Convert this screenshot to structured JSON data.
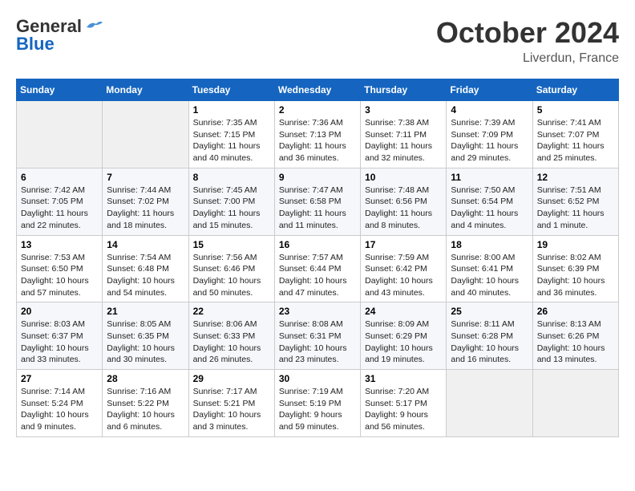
{
  "header": {
    "logo_line1": "General",
    "logo_line2": "Blue",
    "month_title": "October 2024",
    "location": "Liverdun, France"
  },
  "weekdays": [
    "Sunday",
    "Monday",
    "Tuesday",
    "Wednesday",
    "Thursday",
    "Friday",
    "Saturday"
  ],
  "weeks": [
    [
      {
        "day": "",
        "info": ""
      },
      {
        "day": "",
        "info": ""
      },
      {
        "day": "1",
        "info": "Sunrise: 7:35 AM\nSunset: 7:15 PM\nDaylight: 11 hours and 40 minutes."
      },
      {
        "day": "2",
        "info": "Sunrise: 7:36 AM\nSunset: 7:13 PM\nDaylight: 11 hours and 36 minutes."
      },
      {
        "day": "3",
        "info": "Sunrise: 7:38 AM\nSunset: 7:11 PM\nDaylight: 11 hours and 32 minutes."
      },
      {
        "day": "4",
        "info": "Sunrise: 7:39 AM\nSunset: 7:09 PM\nDaylight: 11 hours and 29 minutes."
      },
      {
        "day": "5",
        "info": "Sunrise: 7:41 AM\nSunset: 7:07 PM\nDaylight: 11 hours and 25 minutes."
      }
    ],
    [
      {
        "day": "6",
        "info": "Sunrise: 7:42 AM\nSunset: 7:05 PM\nDaylight: 11 hours and 22 minutes."
      },
      {
        "day": "7",
        "info": "Sunrise: 7:44 AM\nSunset: 7:02 PM\nDaylight: 11 hours and 18 minutes."
      },
      {
        "day": "8",
        "info": "Sunrise: 7:45 AM\nSunset: 7:00 PM\nDaylight: 11 hours and 15 minutes."
      },
      {
        "day": "9",
        "info": "Sunrise: 7:47 AM\nSunset: 6:58 PM\nDaylight: 11 hours and 11 minutes."
      },
      {
        "day": "10",
        "info": "Sunrise: 7:48 AM\nSunset: 6:56 PM\nDaylight: 11 hours and 8 minutes."
      },
      {
        "day": "11",
        "info": "Sunrise: 7:50 AM\nSunset: 6:54 PM\nDaylight: 11 hours and 4 minutes."
      },
      {
        "day": "12",
        "info": "Sunrise: 7:51 AM\nSunset: 6:52 PM\nDaylight: 11 hours and 1 minute."
      }
    ],
    [
      {
        "day": "13",
        "info": "Sunrise: 7:53 AM\nSunset: 6:50 PM\nDaylight: 10 hours and 57 minutes."
      },
      {
        "day": "14",
        "info": "Sunrise: 7:54 AM\nSunset: 6:48 PM\nDaylight: 10 hours and 54 minutes."
      },
      {
        "day": "15",
        "info": "Sunrise: 7:56 AM\nSunset: 6:46 PM\nDaylight: 10 hours and 50 minutes."
      },
      {
        "day": "16",
        "info": "Sunrise: 7:57 AM\nSunset: 6:44 PM\nDaylight: 10 hours and 47 minutes."
      },
      {
        "day": "17",
        "info": "Sunrise: 7:59 AM\nSunset: 6:42 PM\nDaylight: 10 hours and 43 minutes."
      },
      {
        "day": "18",
        "info": "Sunrise: 8:00 AM\nSunset: 6:41 PM\nDaylight: 10 hours and 40 minutes."
      },
      {
        "day": "19",
        "info": "Sunrise: 8:02 AM\nSunset: 6:39 PM\nDaylight: 10 hours and 36 minutes."
      }
    ],
    [
      {
        "day": "20",
        "info": "Sunrise: 8:03 AM\nSunset: 6:37 PM\nDaylight: 10 hours and 33 minutes."
      },
      {
        "day": "21",
        "info": "Sunrise: 8:05 AM\nSunset: 6:35 PM\nDaylight: 10 hours and 30 minutes."
      },
      {
        "day": "22",
        "info": "Sunrise: 8:06 AM\nSunset: 6:33 PM\nDaylight: 10 hours and 26 minutes."
      },
      {
        "day": "23",
        "info": "Sunrise: 8:08 AM\nSunset: 6:31 PM\nDaylight: 10 hours and 23 minutes."
      },
      {
        "day": "24",
        "info": "Sunrise: 8:09 AM\nSunset: 6:29 PM\nDaylight: 10 hours and 19 minutes."
      },
      {
        "day": "25",
        "info": "Sunrise: 8:11 AM\nSunset: 6:28 PM\nDaylight: 10 hours and 16 minutes."
      },
      {
        "day": "26",
        "info": "Sunrise: 8:13 AM\nSunset: 6:26 PM\nDaylight: 10 hours and 13 minutes."
      }
    ],
    [
      {
        "day": "27",
        "info": "Sunrise: 7:14 AM\nSunset: 5:24 PM\nDaylight: 10 hours and 9 minutes."
      },
      {
        "day": "28",
        "info": "Sunrise: 7:16 AM\nSunset: 5:22 PM\nDaylight: 10 hours and 6 minutes."
      },
      {
        "day": "29",
        "info": "Sunrise: 7:17 AM\nSunset: 5:21 PM\nDaylight: 10 hours and 3 minutes."
      },
      {
        "day": "30",
        "info": "Sunrise: 7:19 AM\nSunset: 5:19 PM\nDaylight: 9 hours and 59 minutes."
      },
      {
        "day": "31",
        "info": "Sunrise: 7:20 AM\nSunset: 5:17 PM\nDaylight: 9 hours and 56 minutes."
      },
      {
        "day": "",
        "info": ""
      },
      {
        "day": "",
        "info": ""
      }
    ]
  ]
}
